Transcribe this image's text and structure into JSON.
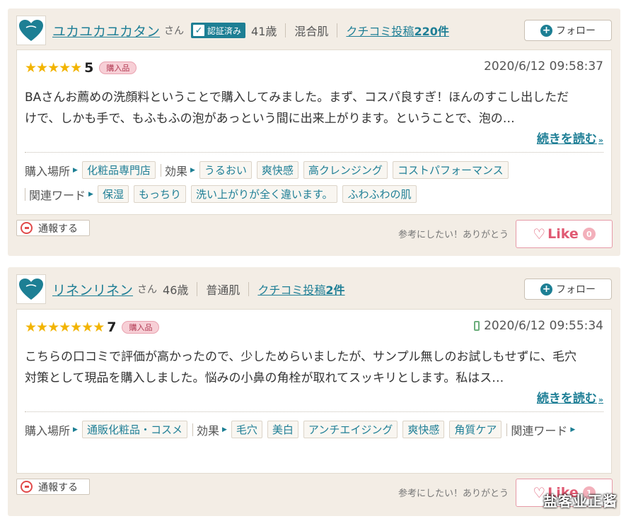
{
  "reviews": [
    {
      "username": "ユカユカユカタン",
      "honorific": "さん",
      "verified_label": "認証済み",
      "verified_check": "✓",
      "age": "41歳",
      "skin_type": "混合肌",
      "posts_prefix": "クチコミ投稿",
      "posts_count": "220件",
      "follow_label": "フォロー",
      "stars": "★★★★★",
      "score": "5",
      "purchase_badge": "購入品",
      "date": "2020/6/12 09:58:37",
      "body_line1": "BAさんお薦めの洗顔料ということで購入してみました。まず、コスパ良すぎ！ほんのすこし出しただ",
      "body_line2": "けで、しかも手で、もふもふの泡があっという間に出来上がります。ということで、泡の…",
      "read_more": "続きを読む",
      "purchase_place_label": "購入場所",
      "purchase_place_tags": [
        "化粧品専門店"
      ],
      "effect_label": "効果",
      "effect_tags": [
        "うるおい",
        "爽快感",
        "高クレンジング",
        "コストパフォーマンス"
      ],
      "related_label": "関連ワード",
      "related_tags": [
        "保湿",
        "もっちり",
        "洗い上がりが全く違います。",
        "ふわふわの肌"
      ],
      "report_label": "通報する",
      "helpful_text": "参考にしたい！ありがとう",
      "like_label": "Like",
      "like_count": "0"
    },
    {
      "username": "リネンリネン",
      "honorific": "さん",
      "age": "46歳",
      "skin_type": "普通肌",
      "posts_prefix": "クチコミ投稿",
      "posts_count": "2件",
      "follow_label": "フォロー",
      "stars": "★★★★★★★",
      "score": "7",
      "purchase_badge": "購入品",
      "date": "2020/6/12 09:55:34",
      "body_line1": "こちらの口コミで評価が高かったので、少しためらいましたが、サンプル無しのお試しもせずに、毛穴",
      "body_line2": "対策として現品を購入しました。悩みの小鼻の角栓が取れてスッキリとします。私はス…",
      "read_more": "続きを読む",
      "purchase_place_label": "購入場所",
      "purchase_place_tags": [
        "通販化粧品・コスメ"
      ],
      "effect_label": "効果",
      "effect_tags": [
        "毛穴",
        "美白",
        "アンチエイジング",
        "爽快感",
        "角質ケア"
      ],
      "related_label": "関連ワード",
      "report_label": "通報する",
      "helpful_text": "参考にしたい！ありがとう",
      "like_label": "Like",
      "like_count": "1"
    }
  ],
  "watermark": "盐客业正酱",
  "colors": {
    "accent": "#1f7f96",
    "star": "#f2b400",
    "like": "#e05a73",
    "card_bg": "#f3ede5"
  },
  "icons": [
    "heart-avatar-icon",
    "check-icon",
    "plus-icon",
    "star-icon",
    "phone-icon",
    "no-entry-icon",
    "heart-icon"
  ]
}
